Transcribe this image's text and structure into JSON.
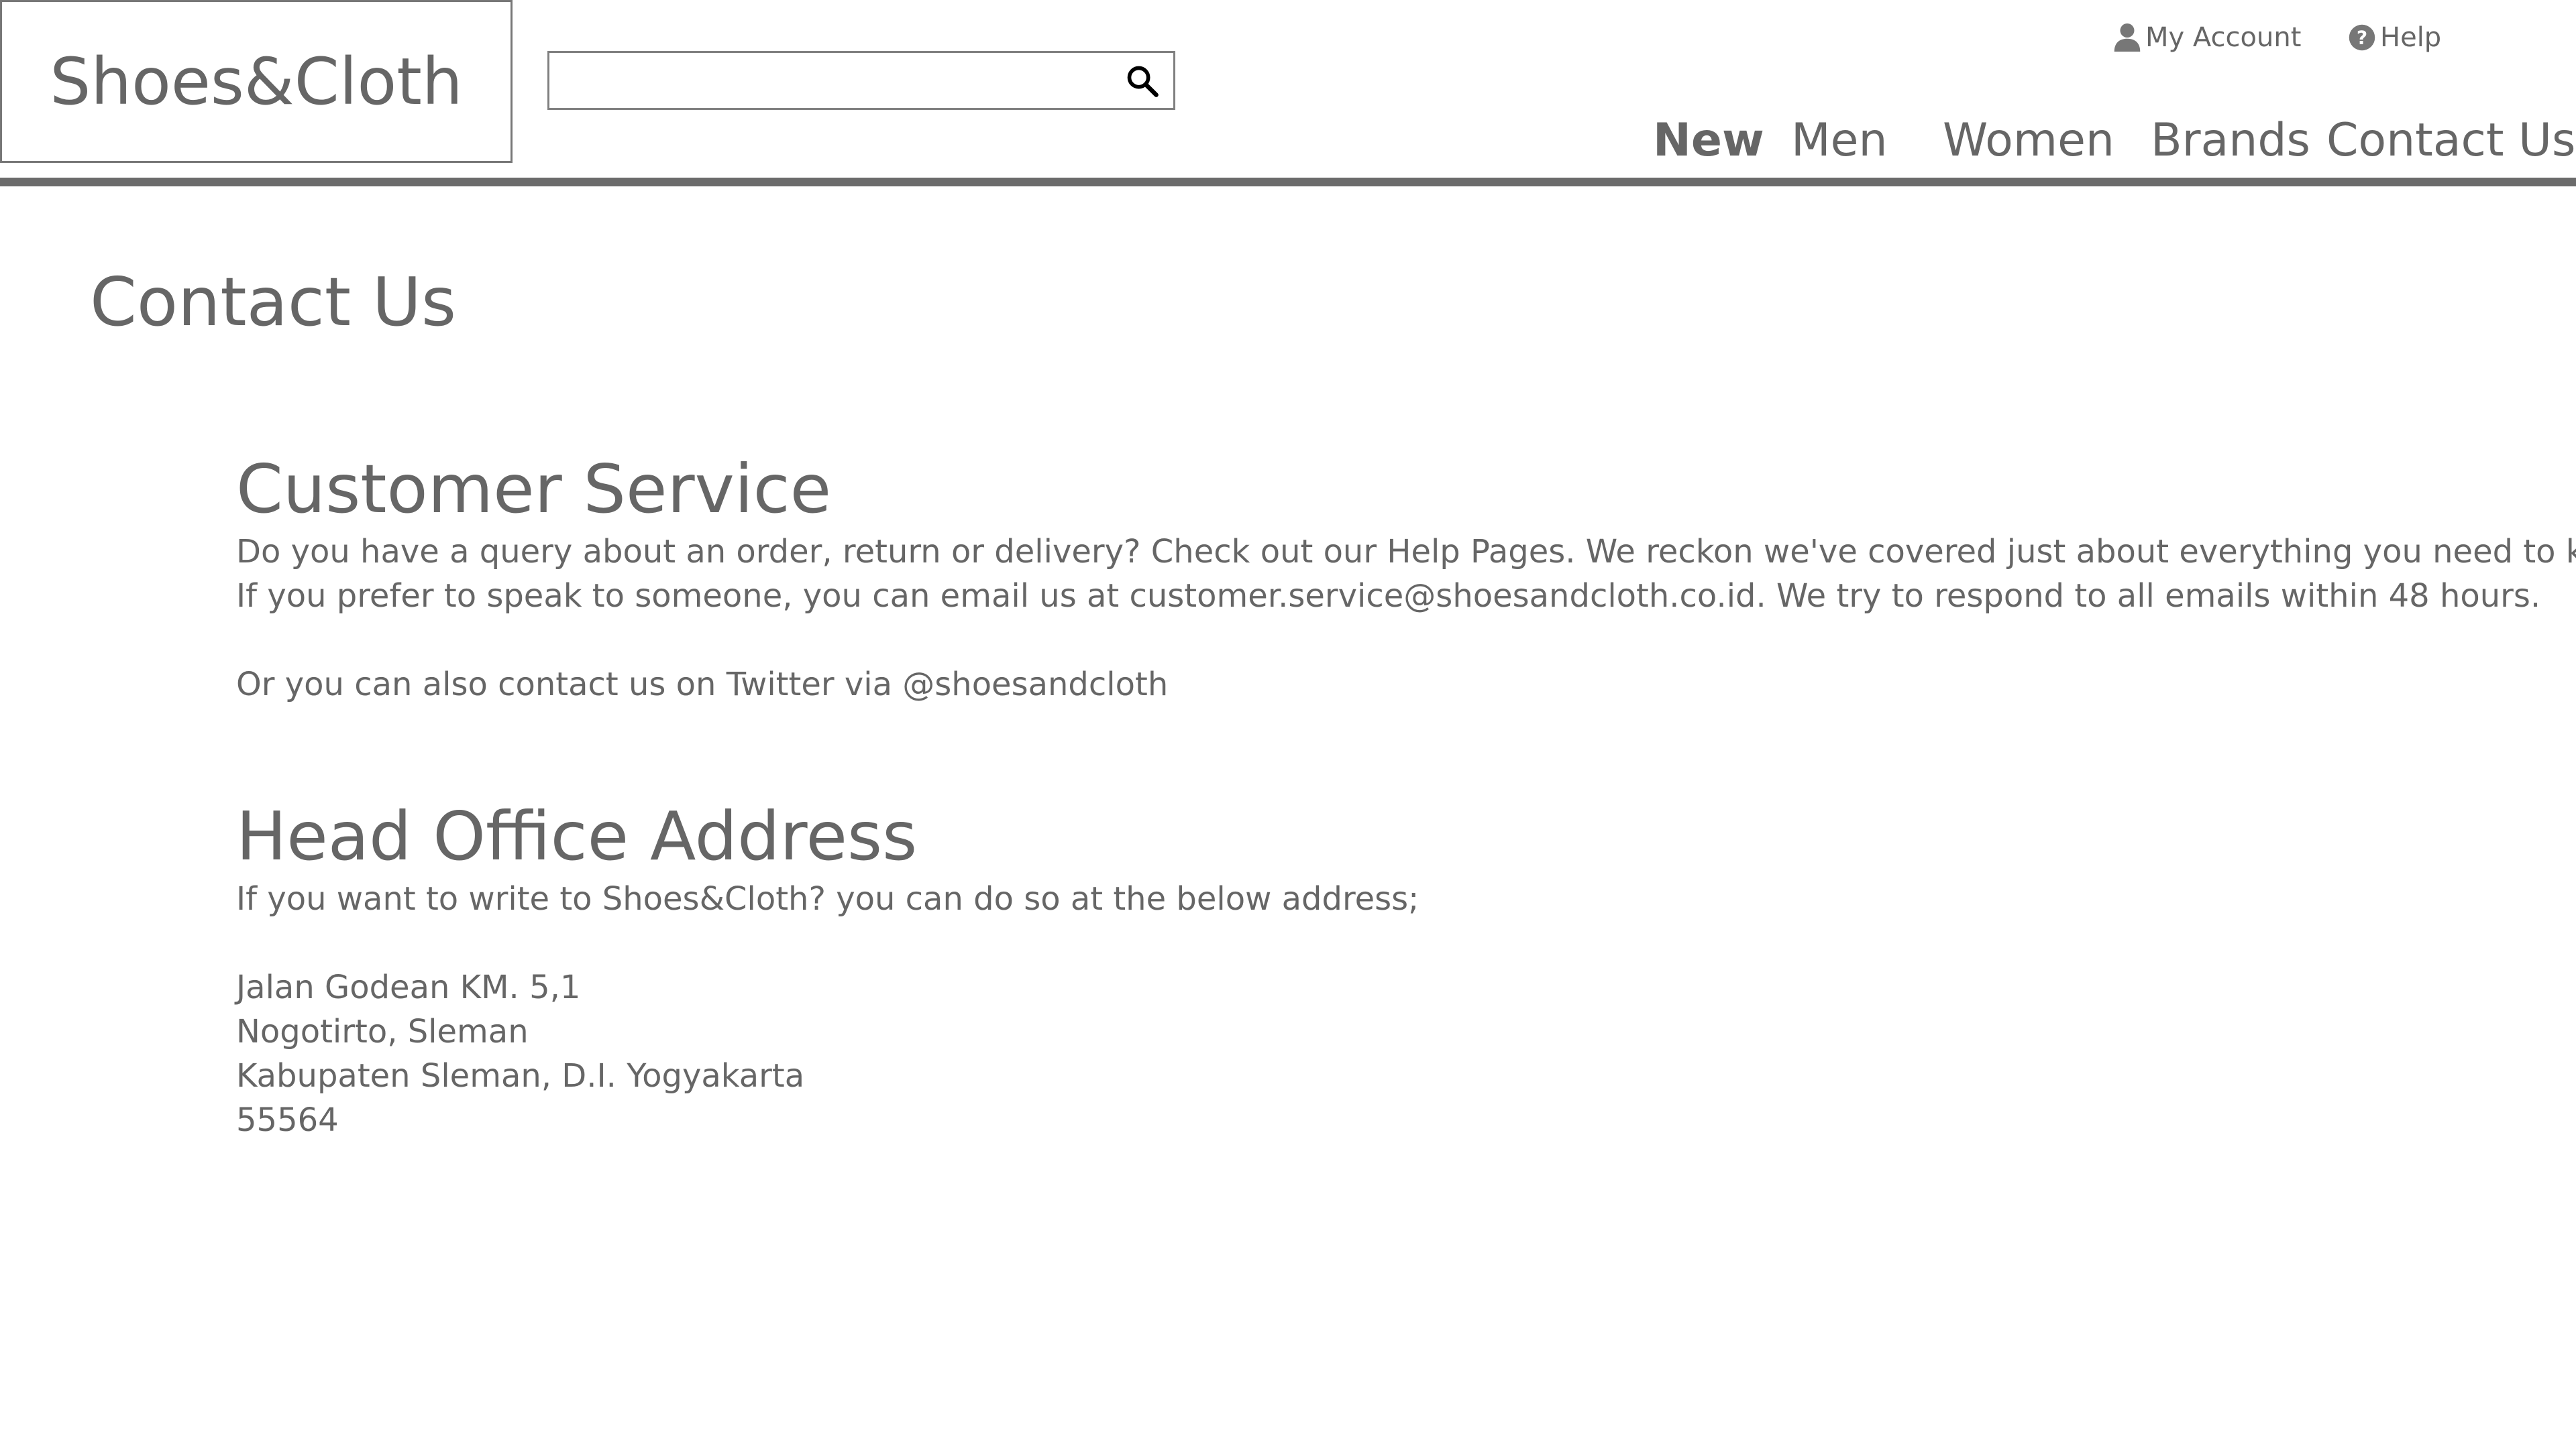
{
  "header": {
    "logo": "Shoes&Cloth",
    "search": {
      "value": "",
      "placeholder": ""
    },
    "top_links": {
      "account": "My Account",
      "help": "Help"
    },
    "nav": [
      "New",
      "Men",
      "Women",
      "Brands",
      "Contact Us"
    ]
  },
  "page": {
    "title": "Contact Us"
  },
  "customer_service": {
    "heading": "Customer Service",
    "line1": "Do you have a query about an order, return or delivery? Check out our Help Pages. We reckon we've covered just about everything you need to know.",
    "line2": "If you prefer to speak to someone, you can email us at customer.service@shoesandcloth.co.id. We try to respond to all emails within 48 hours.",
    "line3": "Or you can also contact us on Twitter via @shoesandcloth"
  },
  "head_office": {
    "heading": "Head Office Address",
    "intro": "If you want to write to Shoes&Cloth? you can do so at the below address;",
    "address": [
      "Jalan Godean KM. 5,1",
      "Nogotirto, Sleman",
      "Kabupaten Sleman, D.I. Yogyakarta",
      "55564"
    ]
  },
  "colors": {
    "text": "#666666",
    "rule": "#6b6b6b",
    "border": "#777777"
  },
  "icons": {
    "search": "search-icon",
    "account": "user-icon",
    "help": "help-circle-icon"
  }
}
